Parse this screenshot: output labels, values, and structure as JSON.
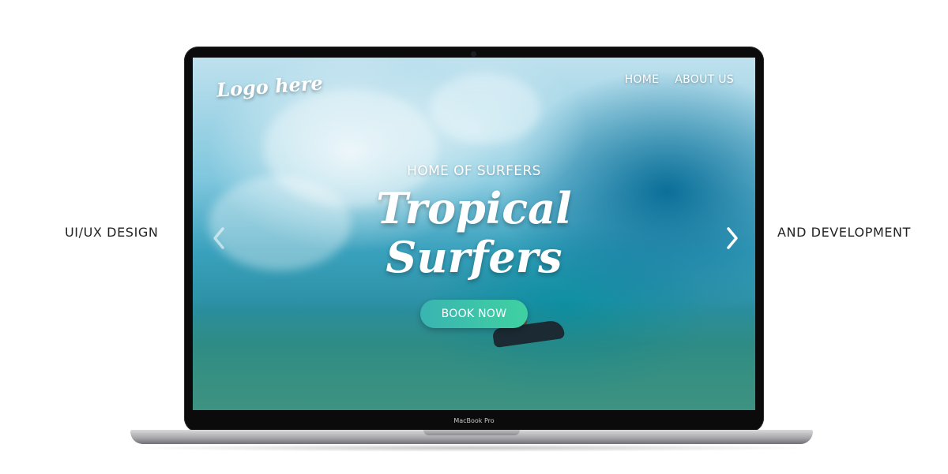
{
  "captions": {
    "left": "UI/UX DESIGN",
    "right": "AND DEVELOPMENT"
  },
  "website": {
    "logo_text": "Logo here",
    "nav": [
      {
        "label": "HOME"
      },
      {
        "label": "ABOUT US"
      }
    ],
    "hero": {
      "kicker": "HOME OF SURFERS",
      "title_line1": "Tropical",
      "title_line2": "Surfers",
      "cta_label": "BOOK NOW"
    },
    "carousel": {
      "prev_icon": "chevron-left-icon",
      "next_icon": "chevron-right-icon"
    }
  },
  "device": {
    "brand_label": "MacBook Pro"
  },
  "colors": {
    "cta_gradient_start": "#3ab4b2",
    "cta_gradient_end": "#3fd1a1",
    "text_on_hero": "#ffffff"
  }
}
